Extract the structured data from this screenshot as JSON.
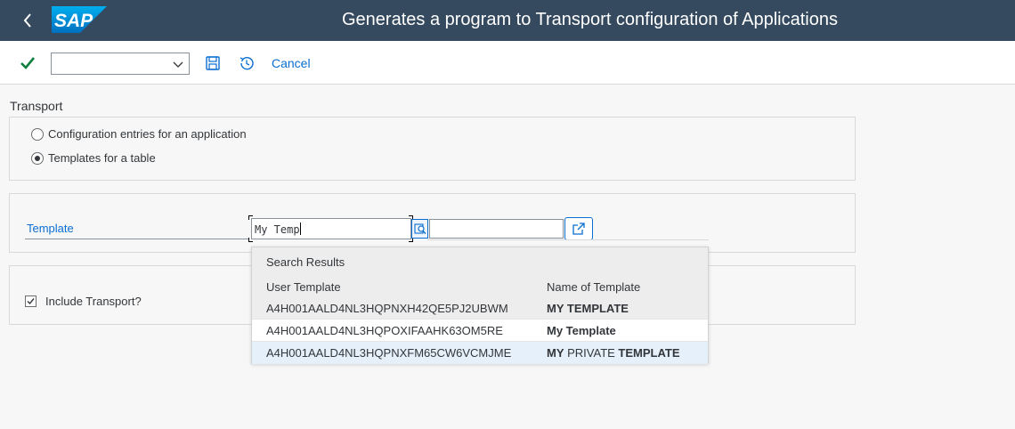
{
  "shell": {
    "title": "Generates a program to Transport configuration of Applications",
    "logo_text": "SAP",
    "bg": "#354a5f"
  },
  "toolbar": {
    "combo_value": "",
    "cancel_label": "Cancel"
  },
  "form": {
    "transport_label": "Transport",
    "radio_config": "Configuration entries for an application",
    "radio_templates": "Templates for a table",
    "selected_radio": "Templates for a table",
    "template_label": "Template",
    "template_value": "My Temp",
    "template_value_2": "",
    "include_transport_label": "Include Transport?",
    "include_transport_checked": true
  },
  "popup": {
    "title": "Search Results",
    "col_user_template": "User Template",
    "col_name": "Name of Template",
    "rows": [
      {
        "id": "A4H001AALD4NL3HQPNXH42QE5PJ2UBWM",
        "name_bold": "MY TEMPLATE",
        "name_rest": "",
        "name_tail": ""
      },
      {
        "id": "A4H001AALD4NL3HQPOXIFAAHK63OM5RE",
        "name_bold": "My Template",
        "name_rest": "",
        "name_tail": ""
      },
      {
        "id": "A4H001AALD4NL3HQPNXFM65CW6VCMJME",
        "name_bold": "MY",
        "name_rest": " PRIVATE ",
        "name_tail": "TEMPLATE"
      }
    ]
  }
}
